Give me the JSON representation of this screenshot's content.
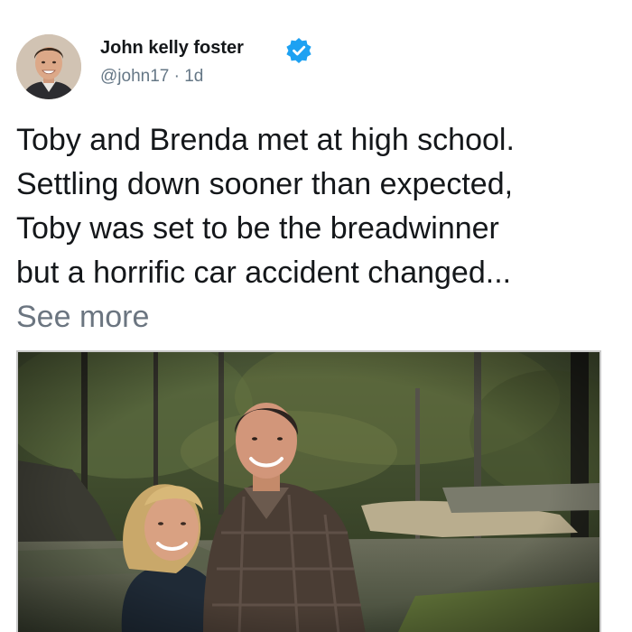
{
  "post": {
    "author_name": "John kelly foster",
    "handle": "@john17",
    "separator": "·",
    "time": "1d",
    "text_lines": [
      "Toby and Brenda met at high school.",
      "Settling down sooner than expected,",
      "Toby was set to be the breadwinner",
      "but a horrific car accident changed..."
    ],
    "see_more": "See more",
    "verified_icon": "verified-badge-icon",
    "colors": {
      "verified_blue": "#1da1f2",
      "handle_gray": "#657786",
      "see_more_gray": "#6b7580",
      "text": "#14171a"
    }
  }
}
